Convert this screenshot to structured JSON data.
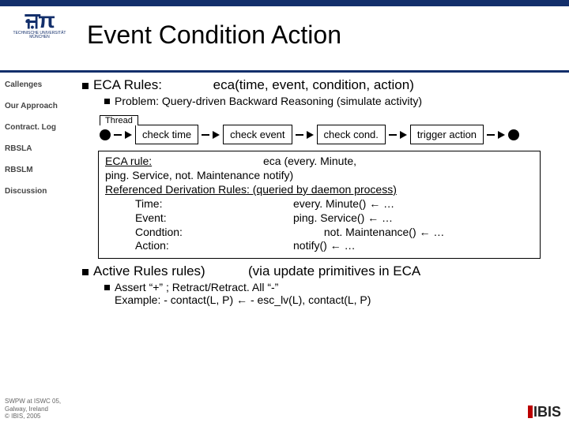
{
  "header": {
    "title": "Event Condition Action",
    "logo_sub": "TECHNISCHE UNIVERSITÄT MÜNCHEN"
  },
  "sidebar": {
    "items": [
      {
        "label": "Callenges"
      },
      {
        "label": "Our Approach"
      },
      {
        "label": "Contract. Log"
      },
      {
        "label": "RBSLA"
      },
      {
        "label": "RBSLM"
      },
      {
        "label": "Discussion"
      }
    ]
  },
  "footer": {
    "venue": "SWPW at ISWC 05, Galway, Ireland",
    "copyright": "© IBIS, 2005",
    "brand": "IBIS"
  },
  "main": {
    "eca_label": "ECA Rules:",
    "eca_sig": "eca(time, event, condition, action)",
    "problem": "Problem: Query-driven Backward Reasoning (simulate activity)",
    "thread_label": "Thread",
    "stages": [
      "check time",
      "check event",
      "check cond.",
      "trigger action"
    ],
    "example": {
      "rule_lhs": "ECA rule:",
      "rule_rhs": "eca (every. Minute,",
      "rule_line2": "ping. Service, not. Maintenance  notify)",
      "ref_title": "Referenced Derivation Rules: (queried by daemon process)",
      "rows": [
        {
          "k": "Time:",
          "v": "every. Minute() ← …"
        },
        {
          "k": "Event:",
          "v": "ping. Service() ← …"
        },
        {
          "k": "Condtion:",
          "v": "          not. Maintenance() ← …"
        },
        {
          "k": "Action:",
          "v": "notify() ← …"
        }
      ]
    },
    "active_lhs": "Active Rules rules)",
    "active_rhs": "(via update primitives in ECA",
    "assert_line1": "Assert “+” ; Retract/Retract. All “-”",
    "assert_line2": "Example: - contact(L, P) ← - esc_lv(L), contact(L, P)"
  }
}
